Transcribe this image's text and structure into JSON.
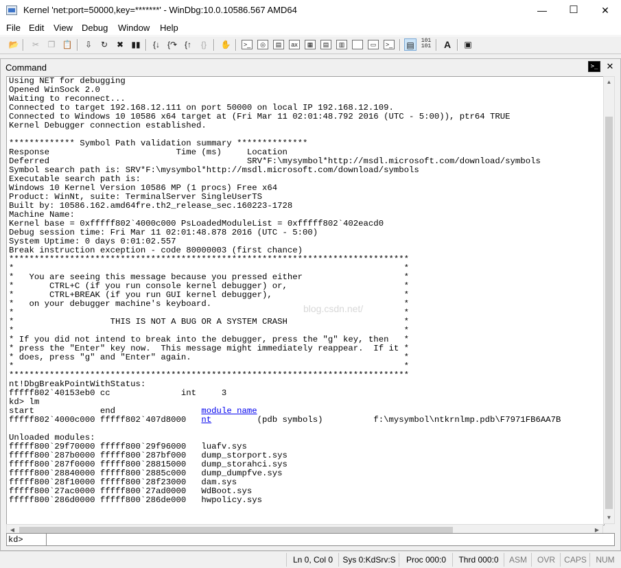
{
  "window": {
    "title": "Kernel 'net:port=50000,key=*******' - WinDbg:10.0.10586.567 AMD64",
    "minimize_glyph": "—",
    "maximize_glyph": "☐",
    "close_glyph": "✕"
  },
  "menu": [
    "File",
    "Edit",
    "View",
    "Debug",
    "Window",
    "Help"
  ],
  "toolbar": {
    "icons": [
      "open-icon",
      "cut-icon",
      "copy-icon",
      "paste-icon",
      "go-icon",
      "restart-icon",
      "stop-debugging-icon",
      "break-icon",
      "step-into-icon",
      "step-over-icon",
      "step-out-icon",
      "run-to-cursor-icon",
      "breakpoint-hand-icon",
      "command-window-icon",
      "watch-window-icon",
      "locals-window-icon",
      "registers-window-icon",
      "memory-window-icon",
      "call-stack-icon",
      "disassembly-window-icon",
      "scratch-pad-icon",
      "processes-threads-icon",
      "source-mode-icon",
      "hex-display-icon",
      "font-icon",
      "options-icon"
    ],
    "hex_label": "101\n101",
    "font_label": "A"
  },
  "command_window": {
    "title": "Command",
    "button_label": ">_",
    "close_glyph": "✕",
    "output_before": "Using NET for debugging\nOpened WinSock 2.0\nWaiting to reconnect...\nConnected to target 192.168.12.111 on port 50000 on local IP 192.168.12.109.\nConnected to Windows 10 10586 x64 target at (Fri Mar 11 02:01:48.792 2016 (UTC - 5:00)), ptr64 TRUE\nKernel Debugger connection established.\n\n************* Symbol Path validation summary **************\nResponse                         Time (ms)     Location\nDeferred                                       SRV*F:\\mysymbol*http://msdl.microsoft.com/download/symbols\nSymbol search path is: SRV*F:\\mysymbol*http://msdl.microsoft.com/download/symbols\nExecutable search path is:\nWindows 10 Kernel Version 10586 MP (1 procs) Free x64\nProduct: WinNt, suite: TerminalServer SingleUserTS\nBuilt by: 10586.162.amd64fre.th2_release_sec.160223-1728\nMachine Name:\nKernel base = 0xfffff802`4000c000 PsLoadedModuleList = 0xfffff802`402eacd0\nDebug session time: Fri Mar 11 02:01:48.878 2016 (UTC - 5:00)\nSystem Uptime: 0 days 0:01:02.557\nBreak instruction exception - code 80000003 (first chance)\n*******************************************************************************\n*                                                                             *\n*   You are seeing this message because you pressed either                    *\n*       CTRL+C (if you run console kernel debugger) or,                       *\n*       CTRL+BREAK (if you run GUI kernel debugger),                          *\n*   on your debugger machine's keyboard.                                      *\n*                                                                             *\n*                   THIS IS NOT A BUG OR A SYSTEM CRASH                       *\n*                                                                             *\n* If you did not intend to break into the debugger, press the \"g\" key, then   *\n* press the \"Enter\" key now.  This message might immediately reappear.  If it *\n* does, press \"g\" and \"Enter\" again.                                          *\n*                                                                             *\n*******************************************************************************\nnt!DbgBreakPointWithStatus:\nfffff802`40153eb0 cc              int     3\nkd> lm\nstart             end                 ",
    "module_name_link": "module name",
    "row_prefix": "\nfffff802`4000c000 fffff802`407d8000   ",
    "nt_link": "nt",
    "row_suffix": "         (pdb symbols)          f:\\mysymbol\\ntkrnlmp.pdb\\F7971FB6AA7B",
    "output_after": "\n\nUnloaded modules:\nfffff800`29f70000 fffff800`29f96000   luafv.sys\nfffff800`287b0000 fffff800`287bf000   dump_storport.sys\nfffff800`287f0000 fffff800`28815000   dump_storahci.sys\nfffff800`28840000 fffff800`2885c000   dump_dumpfve.sys\nfffff800`28f10000 fffff800`28f23000   dam.sys\nfffff800`27ac0000 fffff800`27ad0000   WdBoot.sys\nfffff800`286d0000 fffff800`286de000   hwpolicy.sys",
    "watermark": "blog.csdn.net/",
    "prompt": "kd>",
    "input_value": ""
  },
  "status": {
    "position": "Ln 0, Col 0",
    "sys": "Sys 0:KdSrv:S",
    "proc": "Proc 000:0",
    "thrd": "Thrd 000:0",
    "asm": "ASM",
    "ovr": "OVR",
    "caps": "CAPS",
    "num": "NUM"
  }
}
